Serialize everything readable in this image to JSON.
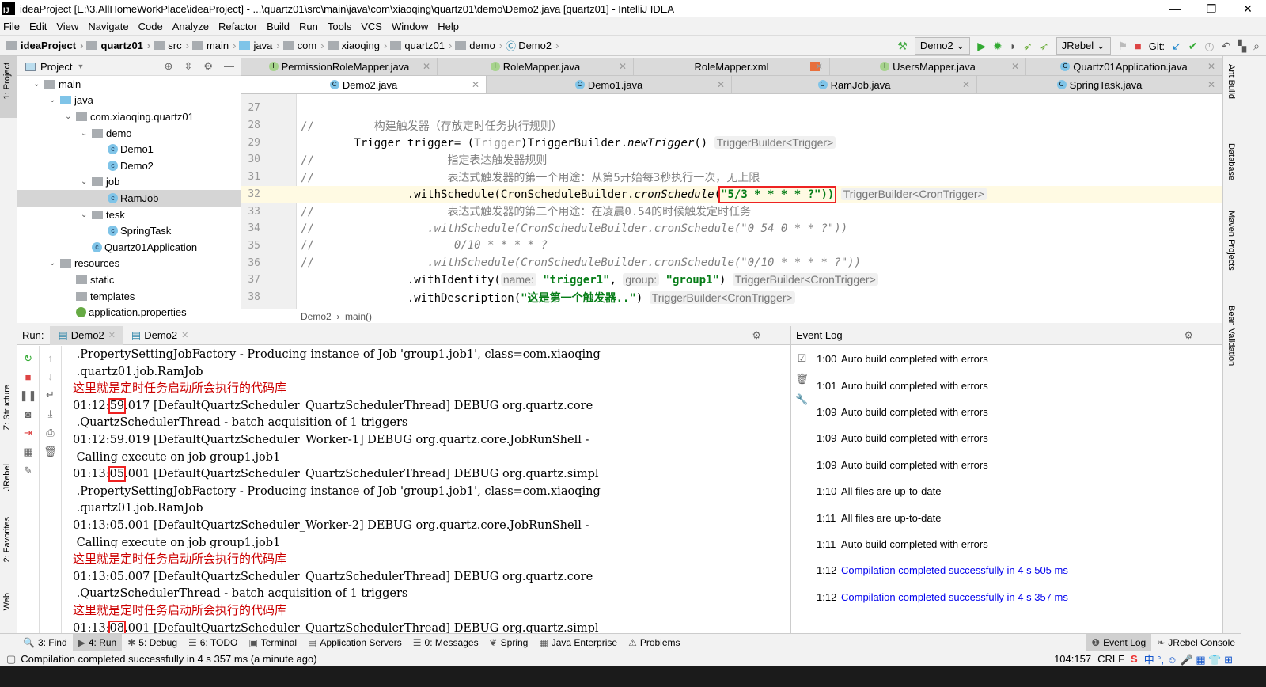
{
  "window": {
    "title": "ideaProject [E:\\3.AllHomeWorkPlace\\ideaProject] - ...\\quartz01\\src\\main\\java\\com\\xiaoqing\\quartz01\\demo\\Demo2.java [quartz01] - IntelliJ IDEA",
    "logo": "IJ",
    "minimize": "—",
    "maximize": "❐",
    "close": "✕"
  },
  "menu": [
    "File",
    "Edit",
    "View",
    "Navigate",
    "Code",
    "Analyze",
    "Refactor",
    "Build",
    "Run",
    "Tools",
    "VCS",
    "Window",
    "Help"
  ],
  "breadcrumb": [
    {
      "label": "ideaProject",
      "bold": true,
      "icon": "module"
    },
    {
      "label": "quartz01",
      "bold": true,
      "icon": "module"
    },
    {
      "label": "src",
      "icon": "folder"
    },
    {
      "label": "main",
      "icon": "folder"
    },
    {
      "label": "java",
      "icon": "source-folder"
    },
    {
      "label": "com",
      "icon": "package"
    },
    {
      "label": "xiaoqing",
      "icon": "package"
    },
    {
      "label": "quartz01",
      "icon": "package"
    },
    {
      "label": "demo",
      "icon": "package"
    },
    {
      "label": "Demo2",
      "icon": "class"
    }
  ],
  "toolbar": {
    "run_config": "Demo2",
    "jrebel": "JRebel",
    "git": "Git:"
  },
  "left_stripe": {
    "project": "1: Project",
    "structure": "Z: Structure",
    "jrebel": "JRebel",
    "favorites": "2: Favorites",
    "web": "Web"
  },
  "right_stripe": {
    "ant": "Ant Build",
    "database": "Database",
    "maven": "Maven Projects",
    "bean": "Bean Validation"
  },
  "project": {
    "title": "Project",
    "tree": [
      {
        "label": "main",
        "depth": 3,
        "type": "folder",
        "open": true
      },
      {
        "label": "java",
        "depth": 4,
        "type": "source",
        "open": true
      },
      {
        "label": "com.xiaoqing.quartz01",
        "depth": 5,
        "type": "package",
        "open": true
      },
      {
        "label": "demo",
        "depth": 6,
        "type": "package",
        "open": true
      },
      {
        "label": "Demo1",
        "depth": 7,
        "type": "class"
      },
      {
        "label": "Demo2",
        "depth": 7,
        "type": "class"
      },
      {
        "label": "job",
        "depth": 6,
        "type": "package",
        "open": true
      },
      {
        "label": "RamJob",
        "depth": 7,
        "type": "class",
        "selected": true
      },
      {
        "label": "tesk",
        "depth": 6,
        "type": "package",
        "open": true
      },
      {
        "label": "SpringTask",
        "depth": 7,
        "type": "class"
      },
      {
        "label": "Quartz01Application",
        "depth": 6,
        "type": "spring-class"
      },
      {
        "label": "resources",
        "depth": 4,
        "type": "folder",
        "open": true
      },
      {
        "label": "static",
        "depth": 5,
        "type": "folder"
      },
      {
        "label": "templates",
        "depth": 5,
        "type": "folder"
      },
      {
        "label": "application.properties",
        "depth": 5,
        "type": "properties"
      }
    ]
  },
  "tabs_row1": [
    {
      "label": "PermissionRoleMapper.java",
      "icon": "I"
    },
    {
      "label": "RoleMapper.java",
      "icon": "I"
    },
    {
      "label": "RoleMapper.xml",
      "icon": "xml"
    },
    {
      "label": "UsersMapper.java",
      "icon": "I"
    },
    {
      "label": "Quartz01Application.java",
      "icon": "C"
    }
  ],
  "tabs_row2": [
    {
      "label": "Demo2.java",
      "icon": "C",
      "active": true
    },
    {
      "label": "Demo1.java",
      "icon": "C"
    },
    {
      "label": "RamJob.java",
      "icon": "C"
    },
    {
      "label": "SpringTask.java",
      "icon": "C"
    }
  ],
  "editor": {
    "lines": [
      {
        "n": "27",
        "tokens": []
      },
      {
        "n": "28",
        "tokens": [
          {
            "t": "//         ",
            "k": "cm"
          },
          {
            "t": "构建触发器（存放定时任务执行规则）",
            "k": "cm"
          }
        ]
      },
      {
        "n": "29",
        "tokens": [
          {
            "t": "        Trigger trigger= (",
            "k": ""
          },
          {
            "t": "Trigger",
            "k": "gr"
          },
          {
            "t": ")TriggerBuilder.",
            "k": ""
          },
          {
            "t": "newTrigger",
            "k": "it"
          },
          {
            "t": "() ",
            "k": ""
          },
          {
            "t": "TriggerBuilder<Trigger>",
            "k": "hint"
          }
        ]
      },
      {
        "n": "30",
        "tokens": [
          {
            "t": "//                    ",
            "k": "cm"
          },
          {
            "t": "指定表达触发器规则",
            "k": "cm"
          }
        ]
      },
      {
        "n": "31",
        "tokens": [
          {
            "t": "//                    ",
            "k": "cm"
          },
          {
            "t": "表达式触发器的第一个用途：从第5开始每3秒执行一次，无上限",
            "k": "cm"
          }
        ]
      },
      {
        "n": "32",
        "current": true,
        "tokens": [
          {
            "t": "                .withSchedule(CronScheduleBuilder.",
            "k": ""
          },
          {
            "t": "cronSchedule",
            "k": "it"
          },
          {
            "t": "(",
            "k": ""
          },
          {
            "t": "\"5/3 * * * * ?\"))",
            "k": "strbox"
          },
          {
            "t": " ",
            "k": ""
          },
          {
            "t": "TriggerBuilder<CronTrigger>",
            "k": "hint"
          }
        ]
      },
      {
        "n": "33",
        "tokens": [
          {
            "t": "//                    ",
            "k": "cm"
          },
          {
            "t": "表达式触发器的第二个用途：在凌晨0.54的时候触发定时任务",
            "k": "cm"
          }
        ]
      },
      {
        "n": "34",
        "tokens": [
          {
            "t": "//                 ",
            "k": "cm"
          },
          {
            "t": ".withSchedule(CronScheduleBuilder.cronSchedule(\"0 54 0 * * ?\"))",
            "k": "cmi"
          }
        ]
      },
      {
        "n": "35",
        "tokens": [
          {
            "t": "//                     ",
            "k": "cm"
          },
          {
            "t": "0/10 * * * * ?",
            "k": "cmi"
          }
        ]
      },
      {
        "n": "36",
        "tokens": [
          {
            "t": "//                 ",
            "k": "cm"
          },
          {
            "t": ".withSchedule(CronScheduleBuilder.cronSchedule(\"0/10 * * * * ?\"))",
            "k": "cmi"
          }
        ]
      },
      {
        "n": "37",
        "tokens": [
          {
            "t": "                .withIdentity(",
            "k": ""
          },
          {
            "t": "name:",
            "k": "hint"
          },
          {
            "t": " ",
            "k": ""
          },
          {
            "t": "\"trigger1\"",
            "k": "str"
          },
          {
            "t": ", ",
            "k": ""
          },
          {
            "t": "group:",
            "k": "hint"
          },
          {
            "t": " ",
            "k": ""
          },
          {
            "t": "\"group1\"",
            "k": "str"
          },
          {
            "t": ") ",
            "k": ""
          },
          {
            "t": "TriggerBuilder<CronTrigger>",
            "k": "hint"
          }
        ]
      },
      {
        "n": "38",
        "tokens": [
          {
            "t": "                .withDescription(",
            "k": ""
          },
          {
            "t": "\"这是第一个触发器..\"",
            "k": "str"
          },
          {
            "t": ") ",
            "k": ""
          },
          {
            "t": "TriggerBuilder<CronTrigger>",
            "k": "hint"
          }
        ]
      }
    ],
    "breadcrumb": [
      "Demo2",
      "main()"
    ]
  },
  "run": {
    "label": "Run:",
    "tabs": [
      "Demo2",
      "Demo2"
    ],
    "lines": [
      {
        "pre": " .PropertySettingJobFactory - Producing instance of Job 'group1.job1', class=com.xiaoqing"
      },
      {
        "pre": " .quartz01.job.RamJob"
      },
      {
        "pre": "这里就是定时任务启动所会执行的代码库",
        "cn": true
      },
      {
        "pre": "01:12:",
        "hl": "59",
        "post": ".017 [DefaultQuartzScheduler_QuartzSchedulerThread] DEBUG org.quartz.core"
      },
      {
        "pre": " .QuartzSchedulerThread - batch acquisition of 1 triggers"
      },
      {
        "pre": "01:12:59.019 [DefaultQuartzScheduler_Worker-1] DEBUG org.quartz.core.JobRunShell -"
      },
      {
        "pre": " Calling execute on job group1.job1"
      },
      {
        "pre": "01:13:",
        "hl": "05",
        "post": ".001 [DefaultQuartzScheduler_QuartzSchedulerThread] DEBUG org.quartz.simpl"
      },
      {
        "pre": " .PropertySettingJobFactory - Producing instance of Job 'group1.job1', class=com.xiaoqing"
      },
      {
        "pre": " .quartz01.job.RamJob"
      },
      {
        "pre": "01:13:05.001 [DefaultQuartzScheduler_Worker-2] DEBUG org.quartz.core.JobRunShell -"
      },
      {
        "pre": " Calling execute on job group1.job1"
      },
      {
        "pre": "这里就是定时任务启动所会执行的代码库",
        "cn": true
      },
      {
        "pre": "01:13:05.007 [DefaultQuartzScheduler_QuartzSchedulerThread] DEBUG org.quartz.core"
      },
      {
        "pre": " .QuartzSchedulerThread - batch acquisition of 1 triggers"
      },
      {
        "pre": "这里就是定时任务启动所会执行的代码库",
        "cn": true
      },
      {
        "pre": "01:13:",
        "hl": "08",
        "post": ".001 [DefaultQuartzScheduler_QuartzSchedulerThread] DEBUG org.quartz.simpl"
      }
    ]
  },
  "event_log": {
    "title": "Event Log",
    "entries": [
      {
        "time": "1:00",
        "text": "Auto build completed with errors"
      },
      {
        "time": "1:01",
        "text": "Auto build completed with errors"
      },
      {
        "time": "1:09",
        "text": "Auto build completed with errors"
      },
      {
        "time": "1:09",
        "text": "Auto build completed with errors"
      },
      {
        "time": "1:09",
        "text": "Auto build completed with errors"
      },
      {
        "time": "1:10",
        "text": "All files are up-to-date"
      },
      {
        "time": "1:11",
        "text": "All files are up-to-date"
      },
      {
        "time": "1:11",
        "text": "Auto build completed with errors"
      },
      {
        "time": "1:12",
        "text": "Compilation completed successfully in 4 s 505 ms",
        "link": true
      },
      {
        "time": "1:12",
        "text": "Compilation completed successfully in 4 s 357 ms",
        "link": true
      }
    ]
  },
  "bottom_tools": [
    {
      "label": "3: Find",
      "icon": "🔍"
    },
    {
      "label": "4: Run",
      "icon": "▶",
      "active": true
    },
    {
      "label": "5: Debug",
      "icon": "✱"
    },
    {
      "label": "6: TODO",
      "icon": "☰"
    },
    {
      "label": "Terminal",
      "icon": "▣"
    },
    {
      "label": "Application Servers",
      "icon": "▤"
    },
    {
      "label": "0: Messages",
      "icon": "☰"
    },
    {
      "label": "Spring",
      "icon": "❦"
    },
    {
      "label": "Java Enterprise",
      "icon": "▦"
    },
    {
      "label": "Problems",
      "icon": "⚠"
    }
  ],
  "bottom_tools_right": [
    {
      "label": "Event Log",
      "icon": "❶",
      "active": true
    },
    {
      "label": "JRebel Console",
      "icon": "❧"
    }
  ],
  "status": {
    "message": "Compilation completed successfully in 4 s 357 ms (a minute ago)",
    "position": "104:157",
    "line_sep": "CRLF"
  }
}
